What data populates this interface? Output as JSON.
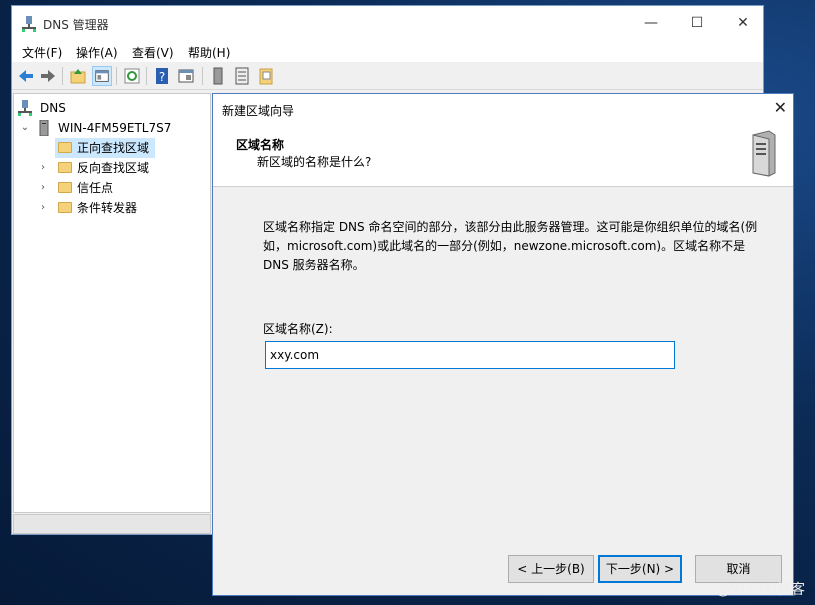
{
  "window": {
    "title": "DNS 管理器",
    "min": "—",
    "max": "☐",
    "close": "✕"
  },
  "menu": [
    "文件(F)",
    "操作(A)",
    "查看(V)",
    "帮助(H)"
  ],
  "tree": {
    "root": "DNS",
    "server": "WIN-4FM59ETL7S7",
    "children": [
      "正向查找区域",
      "反向查找区域",
      "信任点",
      "条件转发器"
    ]
  },
  "wizard": {
    "title": "新建区域向导",
    "close": "✕",
    "header_title": "区域名称",
    "header_subtitle": "新区域的名称是什么?",
    "description": "区域名称指定 DNS 命名空间的部分，该部分由此服务器管理。这可能是你组织单位的域名(例如，microsoft.com)或此域名的一部分(例如，newzone.microsoft.com)。区域名称不是 DNS 服务器名称。",
    "zone_label": "区域名称(Z):",
    "zone_value": "xxy.com",
    "back_button": "< 上一步(B)",
    "next_button": "下一步(N) >",
    "cancel_button": "取消"
  },
  "watermark": "@51CTO博客",
  "colors": {
    "accent": "#0078d7",
    "selection": "#cce8ff",
    "folder": "#f5d27a"
  }
}
